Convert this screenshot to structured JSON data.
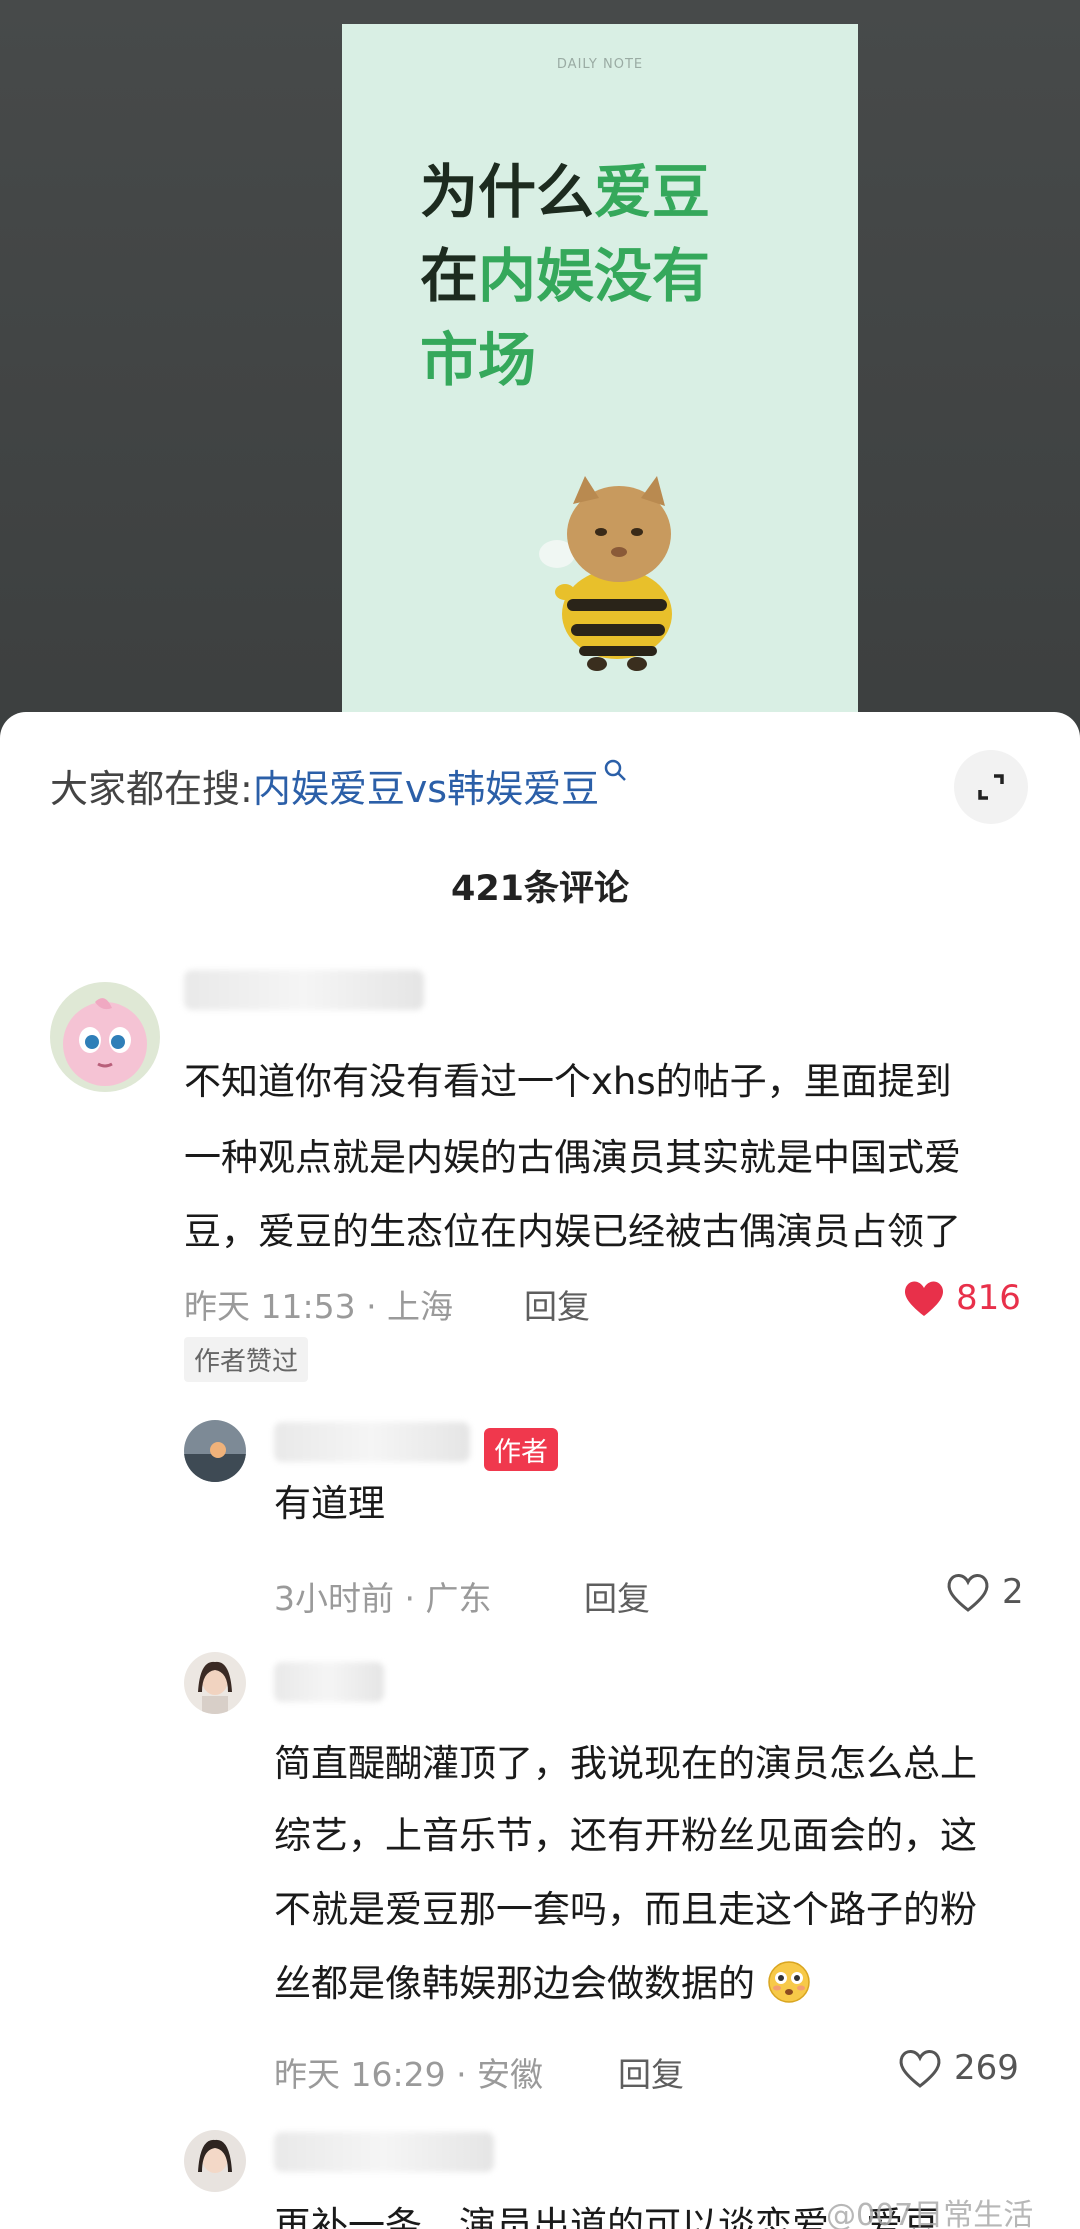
{
  "note": {
    "label": "DAILY NOTE",
    "title_line1_a": "为什么",
    "title_line1_b": "爱豆",
    "title_line2_a": "在",
    "title_line2_b": "内娱没有",
    "title_line3": "市场"
  },
  "search": {
    "prefix": "大家都在搜:",
    "term": "内娱爱豆vs韩娱爱豆"
  },
  "comments_header": {
    "count_label": "421条评论"
  },
  "comments": [
    {
      "lines": [
        "不知道你有没有看过一个xhs的帖子，里面提到",
        "一种观点就是内娱的古偶演员其实就是中国式爱",
        "豆，爱豆的生态位在内娱已经被古偶演员占领了"
      ],
      "meta": "昨天 11:53 · 上海",
      "reply_label": "回复",
      "likes": "816",
      "liked": true,
      "tag": "作者赞过"
    },
    {
      "badge": "作者",
      "lines": [
        "有道理"
      ],
      "meta": "3小时前 · 广东",
      "reply_label": "回复",
      "likes": "2",
      "liked": false
    },
    {
      "lines": [
        "简直醍醐灌顶了，我说现在的演员怎么总上",
        "综艺，上音乐节，还有开粉丝见面会的，这",
        "不就是爱豆那一套吗，而且走这个路子的粉",
        "丝都是像韩娱那边会做数据的"
      ],
      "meta": "昨天 16:29 · 安徽",
      "reply_label": "回复",
      "likes": "269",
      "liked": false
    },
    {
      "lines": [
        "再补一条，演员出道的可以谈恋爱，爱豆"
      ]
    }
  ],
  "watermark": "@007日常生活",
  "colors": {
    "accent_green": "#35a85b",
    "like_red": "#e8304a",
    "author_badge": "#f0384d",
    "link_blue": "#2b5fa8"
  }
}
